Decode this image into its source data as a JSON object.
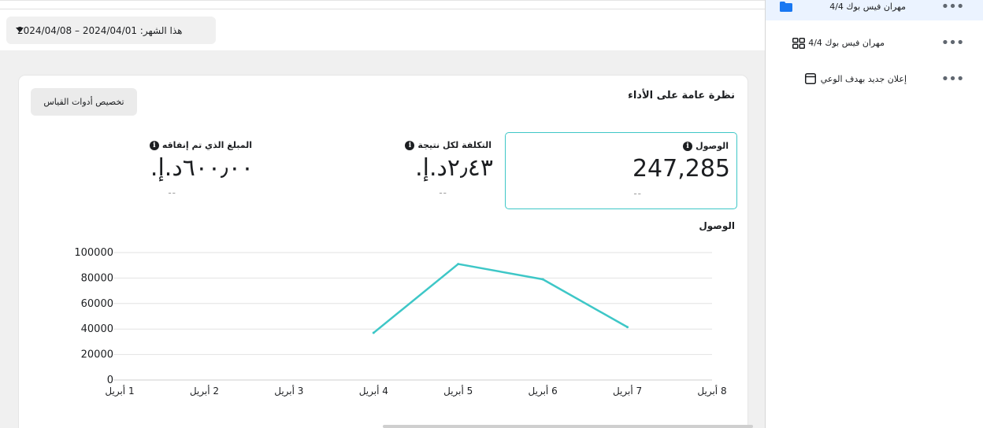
{
  "header": {
    "date_range": "هذا الشهر: 2024/04/01 – 2024/04/08"
  },
  "overview": {
    "title": "نظرة عامة على الأداء",
    "customize_label": "تخصيص أدوات القياس",
    "metrics": [
      {
        "label": "الوصول",
        "value": "247,285",
        "delta": "--"
      },
      {
        "label": "التكلفة لكل نتيجة",
        "value": "٢٫٤٣د.إ.",
        "delta": "--"
      },
      {
        "label": "المبلغ الذي تم إنفاقه",
        "value": "٦٠٠٫٠٠د.إ.",
        "delta": "--"
      }
    ],
    "info_glyph": "i"
  },
  "chart_data": {
    "type": "line",
    "title": "الوصول",
    "categories": [
      "1 أبريل",
      "2 أبريل",
      "3 أبريل",
      "4 أبريل",
      "5 أبريل",
      "6 أبريل",
      "7 أبريل",
      "8 أبريل"
    ],
    "series": [
      {
        "values": [
          null,
          null,
          null,
          37000,
          91000,
          79000,
          41500,
          null
        ]
      }
    ],
    "ylim": [
      0,
      100000
    ],
    "yticks": [
      0,
      20000,
      40000,
      60000,
      80000,
      100000
    ],
    "grid": true,
    "line_color": "#3ec7c7"
  },
  "sidebar": {
    "items": [
      {
        "label": "مهران فيس بوك 4/4",
        "icon": "folder-icon",
        "more": "•••"
      },
      {
        "label": "مهران فيس بوك 4/4",
        "icon": "grid-icon",
        "more": "•••"
      },
      {
        "label": "إعلان جديد بهدف الوعي",
        "icon": "ad-icon",
        "more": "•••"
      }
    ]
  },
  "colors": {
    "accent": "#3ec7c7",
    "folder": "#1877f2"
  }
}
